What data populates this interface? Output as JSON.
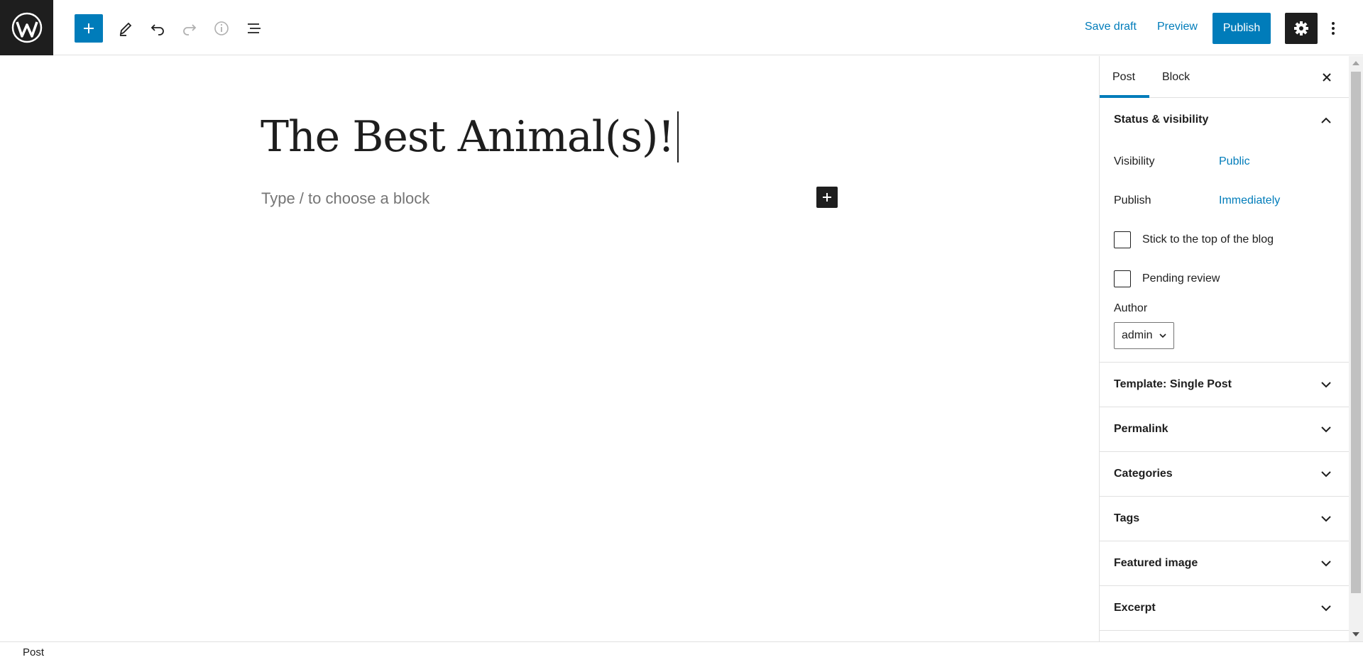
{
  "toolbar": {
    "save_draft": "Save draft",
    "preview": "Preview",
    "publish": "Publish"
  },
  "editor": {
    "title": "The Best Animal(s)!",
    "placeholder": "Type / to choose a block"
  },
  "sidebar": {
    "tabs": [
      {
        "label": "Post"
      },
      {
        "label": "Block"
      }
    ],
    "status": {
      "heading": "Status & visibility",
      "visibility_label": "Visibility",
      "visibility_value": "Public",
      "publish_label": "Publish",
      "publish_value": "Immediately",
      "sticky_label": "Stick to the top of the blog",
      "pending_label": "Pending review",
      "author_label": "Author",
      "author_value": "admin"
    },
    "panels": [
      {
        "label": "Template: Single Post"
      },
      {
        "label": "Permalink"
      },
      {
        "label": "Categories"
      },
      {
        "label": "Tags"
      },
      {
        "label": "Featured image"
      },
      {
        "label": "Excerpt"
      }
    ]
  },
  "footer": {
    "breadcrumb": "Post"
  },
  "colors": {
    "accent": "#007cba",
    "dark": "#1e1e1e"
  },
  "icons": [
    "wordpress-logo-icon",
    "plus-icon",
    "pencil-icon",
    "undo-icon",
    "redo-icon",
    "info-icon",
    "list-view-icon",
    "gear-icon",
    "more-vertical-icon",
    "close-icon",
    "chevron-up-icon",
    "chevron-down-icon"
  ]
}
